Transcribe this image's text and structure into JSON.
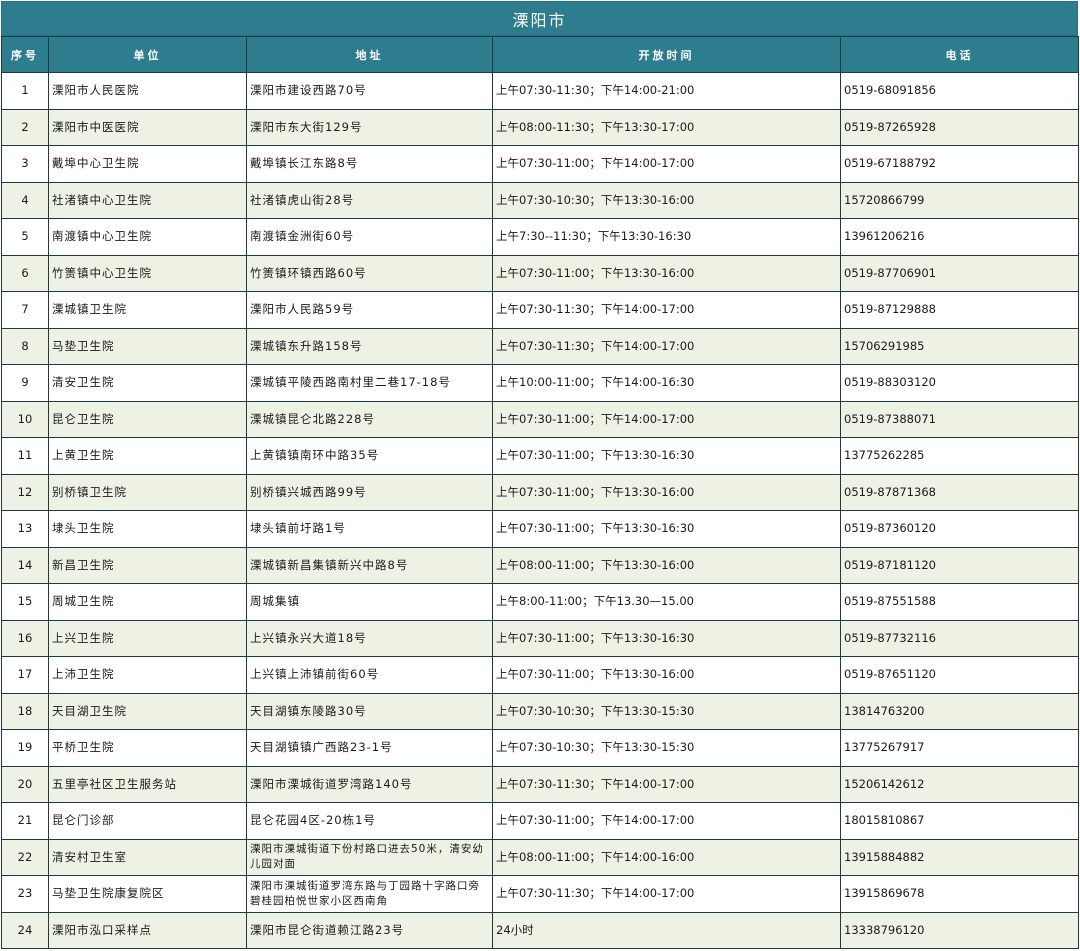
{
  "title": "溧阳市",
  "headers": {
    "index": "序号",
    "unit": "单位",
    "address": "地址",
    "hours": "开放时间",
    "phone": "电话"
  },
  "rows": [
    {
      "index": "1",
      "unit": "溧阳市人民医院",
      "address": "溧阳市建设西路70号",
      "hours": "上午07:30-11:30；下午14:00-21:00",
      "phone": "0519-68091856"
    },
    {
      "index": "2",
      "unit": "溧阳市中医医院",
      "address": "溧阳市东大街129号",
      "hours": "上午08:00-11:30；下午13:30-17:00",
      "phone": "0519-87265928"
    },
    {
      "index": "3",
      "unit": "戴埠中心卫生院",
      "address": "戴埠镇长江东路8号",
      "hours": "上午07:30-11:00；下午14:00-17:00",
      "phone": "0519-67188792"
    },
    {
      "index": "4",
      "unit": "社渚镇中心卫生院",
      "address": "社渚镇虎山街28号",
      "hours": "上午07:30-10:30；下午13:30-16:00",
      "phone": "15720866799"
    },
    {
      "index": "5",
      "unit": "南渡镇中心卫生院",
      "address": "南渡镇金洲街60号",
      "hours": "上午7:30--11:30；下午13:30-16:30",
      "phone": "13961206216"
    },
    {
      "index": "6",
      "unit": "竹箦镇中心卫生院",
      "address": "竹箦镇环镇西路60号",
      "hours": "上午07:30-11:00；下午13:30-16:00",
      "phone": "0519-87706901"
    },
    {
      "index": "7",
      "unit": "溧城镇卫生院",
      "address": "溧阳市人民路59号",
      "hours": "上午07:30-11:30；下午14:00-17:00",
      "phone": "0519-87129888"
    },
    {
      "index": "8",
      "unit": "马垫卫生院",
      "address": "溧城镇东升路158号",
      "hours": "上午07:30-11:30；下午14:00-17:00",
      "phone": "15706291985"
    },
    {
      "index": "9",
      "unit": "清安卫生院",
      "address": "溧城镇平陵西路南村里二巷17-18号",
      "hours": "上午10:00-11:00；下午14:00-16:30",
      "phone": "0519-88303120"
    },
    {
      "index": "10",
      "unit": "昆仑卫生院",
      "address": "溧城镇昆仑北路228号",
      "hours": "上午07:30-11:00；下午14:00-17:00",
      "phone": "0519-87388071"
    },
    {
      "index": "11",
      "unit": "上黄卫生院",
      "address": "上黄镇镇南环中路35号",
      "hours": "上午07:30-11:00；下午13:30-16:30",
      "phone": "13775262285"
    },
    {
      "index": "12",
      "unit": "别桥镇卫生院",
      "address": "别桥镇兴城西路99号",
      "hours": "上午07:30-11:00；下午13:30-16:00",
      "phone": "0519-87871368"
    },
    {
      "index": "13",
      "unit": "埭头卫生院",
      "address": "埭头镇前圩路1号",
      "hours": "上午07:30-11:00；下午13:30-16:30",
      "phone": "0519-87360120"
    },
    {
      "index": "14",
      "unit": "新昌卫生院",
      "address": "溧城镇新昌集镇新兴中路8号",
      "hours": "上午08:00-11:00；下午13:30-16:00",
      "phone": "0519-87181120"
    },
    {
      "index": "15",
      "unit": "周城卫生院",
      "address": "周城集镇",
      "hours": "上午8:00-11:00；下午13.30—15.00",
      "phone": "0519-87551588"
    },
    {
      "index": "16",
      "unit": "上兴卫生院",
      "address": "上兴镇永兴大道18号",
      "hours": "上午07:30-11:00；下午13:30-16:30",
      "phone": "0519-87732116"
    },
    {
      "index": "17",
      "unit": "上沛卫生院",
      "address": "上兴镇上沛镇前街60号",
      "hours": "上午07:30-11:00；下午13:30-16:00",
      "phone": "0519-87651120"
    },
    {
      "index": "18",
      "unit": "天目湖卫生院",
      "address": "天目湖镇东陵路30号",
      "hours": "上午07:30-10:30；下午13:30-15:30",
      "phone": "13814763200"
    },
    {
      "index": "19",
      "unit": "平桥卫生院",
      "address": "天目湖镇镇广西路23-1号",
      "hours": "上午07:30-10:30；下午13:30-15:30",
      "phone": "13775267917"
    },
    {
      "index": "20",
      "unit": "五里亭社区卫生服务站",
      "address": "溧阳市溧城街道罗湾路140号",
      "hours": "上午07:30-11:30；下午14:00-17:00",
      "phone": "15206142612"
    },
    {
      "index": "21",
      "unit": "昆仑门诊部",
      "address": "昆仑花园4区-20栋1号",
      "hours": "上午07:30-11:00；下午14:00-17:00",
      "phone": "18015810867"
    },
    {
      "index": "22",
      "unit": "清安村卫生室",
      "address": "溧阳市溧城街道下份村路口进去50米，清安幼儿园对面",
      "hours": "上午08:00-11:00；下午14:00-16:00",
      "phone": "13915884882"
    },
    {
      "index": "23",
      "unit": "马垫卫生院康复院区",
      "address": "溧阳市溧城街道罗湾东路与丁园路十字路口旁 碧桂园柏悦世家小区西南角",
      "hours": "上午07:30-11:30；下午14:00-17:00",
      "phone": "13915869678"
    },
    {
      "index": "24",
      "unit": "溧阳市泓口采样点",
      "address": "溧阳市昆仑街道赖江路23号",
      "hours": "24小时",
      "phone": "13338796120"
    }
  ]
}
